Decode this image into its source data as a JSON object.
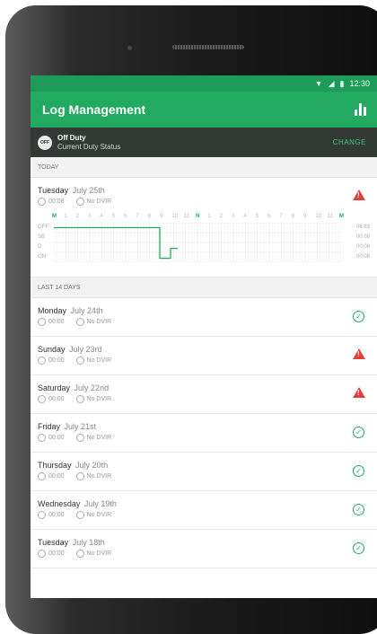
{
  "status_bar": {
    "time": "12:30"
  },
  "app": {
    "title": "Log Management",
    "chart_icon": "bar-chart-icon"
  },
  "duty": {
    "badge": "OFF",
    "status": "Off Duty",
    "subtitle": "Current Duty Status",
    "change_label": "CHANGE"
  },
  "today": {
    "section": "TODAY",
    "day": "Tuesday",
    "date": "July 25th",
    "time": "00:08",
    "dvir": "No DVIR",
    "status": "warning",
    "hours": [
      "M",
      "1",
      "2",
      "3",
      "4",
      "5",
      "6",
      "7",
      "8",
      "9",
      "10",
      "11",
      "N",
      "1",
      "2",
      "3",
      "4",
      "5",
      "6",
      "7",
      "8",
      "9",
      "10",
      "11",
      "M"
    ],
    "rows": [
      {
        "label": "OFF",
        "total": "06:83"
      },
      {
        "label": "SB",
        "total": "00:08"
      },
      {
        "label": "D",
        "total": "00:08"
      },
      {
        "label": "ON",
        "total": "00:08"
      }
    ]
  },
  "history": {
    "section": "LAST 14 DAYS",
    "days": [
      {
        "day": "Monday",
        "date": "July 24th",
        "time": "00:00",
        "dvir": "No DVIR",
        "status": "ok"
      },
      {
        "day": "Sunday",
        "date": "July 23rd",
        "time": "00:00",
        "dvir": "No DVIR",
        "status": "warning"
      },
      {
        "day": "Saturday",
        "date": "July 22nd",
        "time": "00:00",
        "dvir": "No DVIR",
        "status": "warning"
      },
      {
        "day": "Friday",
        "date": "July 21st",
        "time": "00:00",
        "dvir": "No DVIR",
        "status": "ok"
      },
      {
        "day": "Thursday",
        "date": "July 20th",
        "time": "00:00",
        "dvir": "No DVIR",
        "status": "ok"
      },
      {
        "day": "Wednesday",
        "date": "July 19th",
        "time": "00:00",
        "dvir": "No DVIR",
        "status": "ok"
      },
      {
        "day": "Tuesday",
        "date": "July 18th",
        "time": "00:00",
        "dvir": "No DVIR",
        "status": "ok"
      }
    ]
  },
  "colors": {
    "primary": "#22aa60",
    "warning": "#e0413a",
    "duty_bar": "#333a36"
  }
}
